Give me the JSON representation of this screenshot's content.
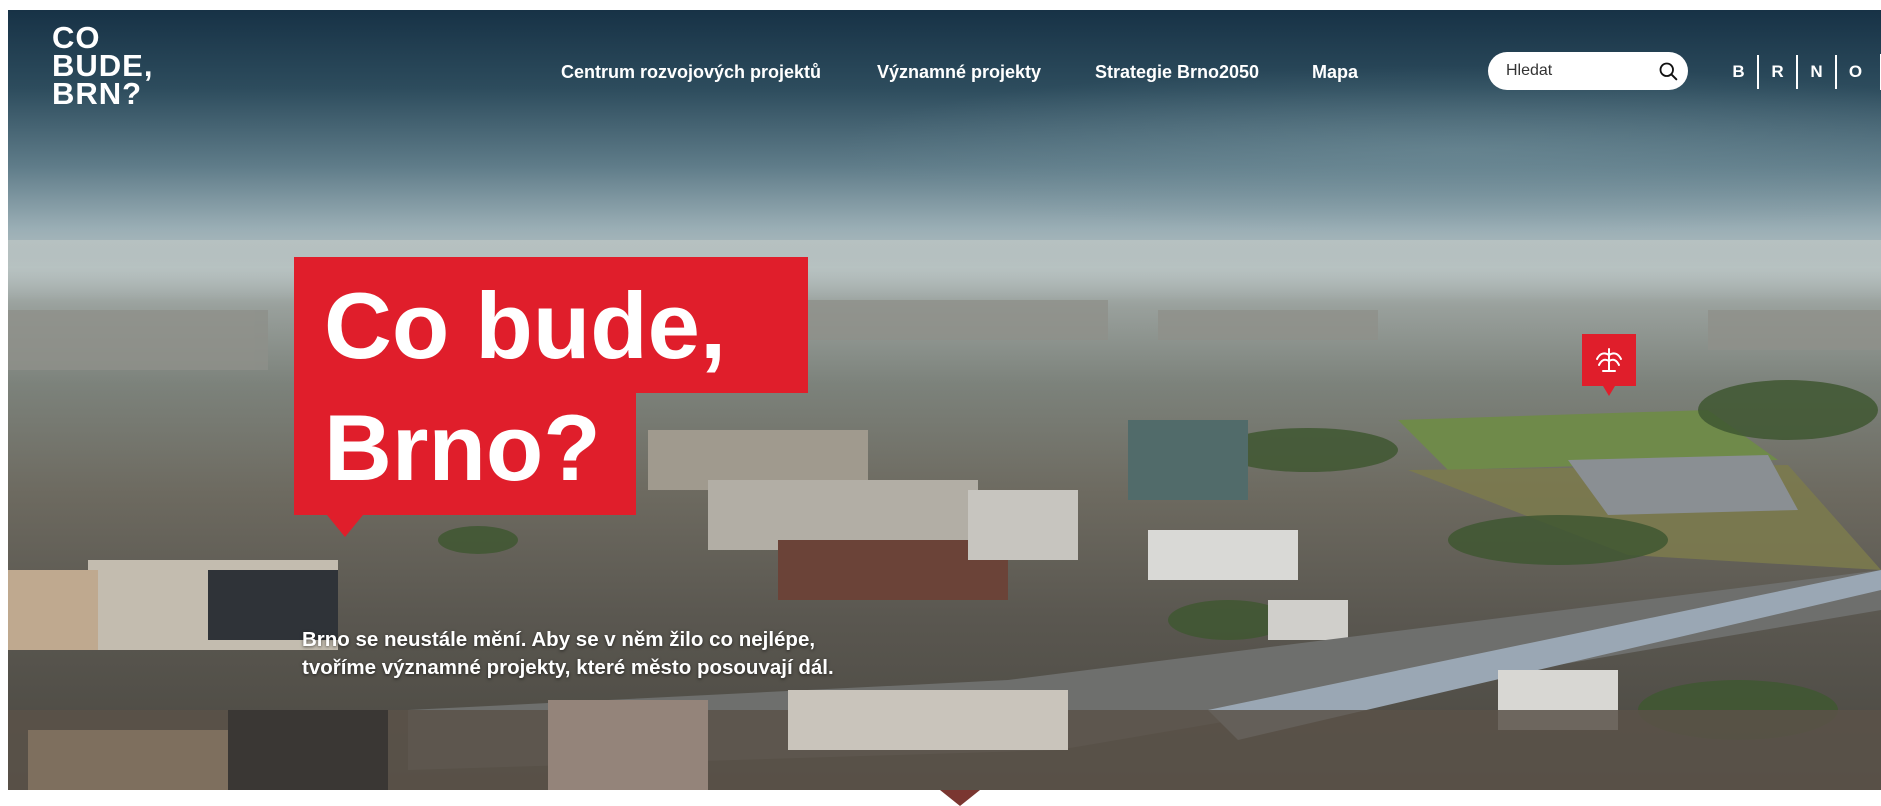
{
  "logo": {
    "lines": [
      "CO",
      "BUDE,",
      "BRN?"
    ]
  },
  "nav": {
    "items": [
      {
        "label": "Centrum rozvojových projektů"
      },
      {
        "label": "Významné projekty"
      },
      {
        "label": "Strategie Brno2050"
      },
      {
        "label": "Mapa"
      }
    ]
  },
  "search": {
    "placeholder": "Hledat",
    "icon": "search-icon"
  },
  "brand_mark": {
    "letters": [
      "B",
      "R",
      "N",
      "O"
    ]
  },
  "hero": {
    "title_line1": "Co bude,",
    "title_line2": "Brno?",
    "tagline_line1": "Brno se neustále mění. Aby se v něm žilo co nejlépe,",
    "tagline_line2": "tvoříme významné projekty, které město posouvají dál."
  },
  "colors": {
    "accent": "#e01e2b",
    "text_on_dark": "#ffffff",
    "sky_top": "#173246"
  }
}
